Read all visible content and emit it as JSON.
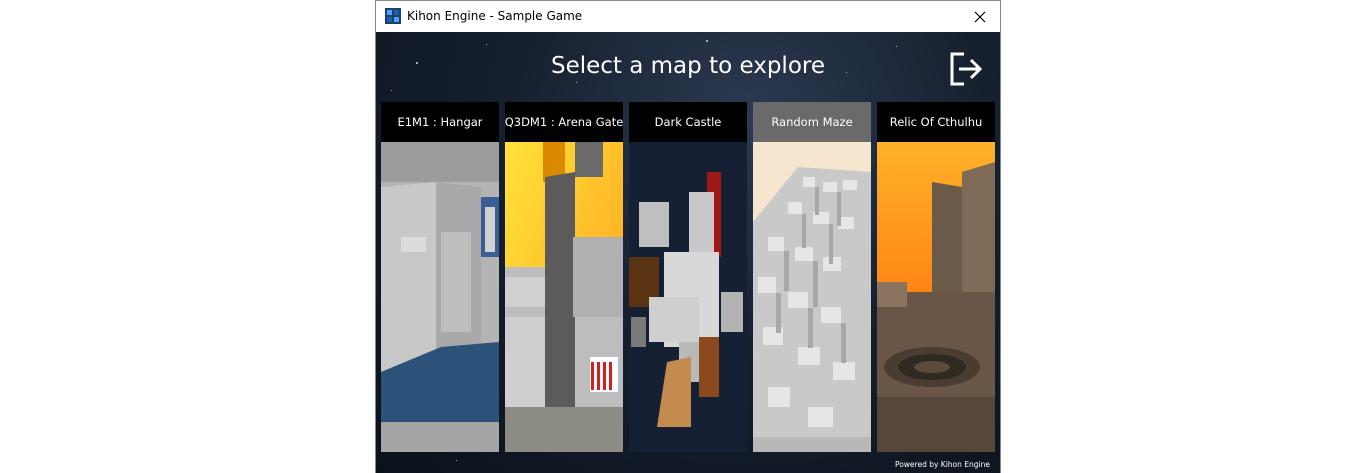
{
  "window": {
    "title": "Kihon Engine - Sample Game",
    "app_icon": "kihon-app-icon",
    "close_icon": "close-icon"
  },
  "screen": {
    "heading": "Select a map to explore",
    "exit_icon": "exit-icon",
    "footer": "Powered by Kihon Engine"
  },
  "maps": [
    {
      "label": "E1M1 : Hangar",
      "selected": false
    },
    {
      "label": "Q3DM1 : Arena Gate",
      "selected": false
    },
    {
      "label": "Dark Castle",
      "selected": false
    },
    {
      "label": "Random Maze",
      "selected": true
    },
    {
      "label": "Relic Of Cthulhu",
      "selected": false
    }
  ]
}
